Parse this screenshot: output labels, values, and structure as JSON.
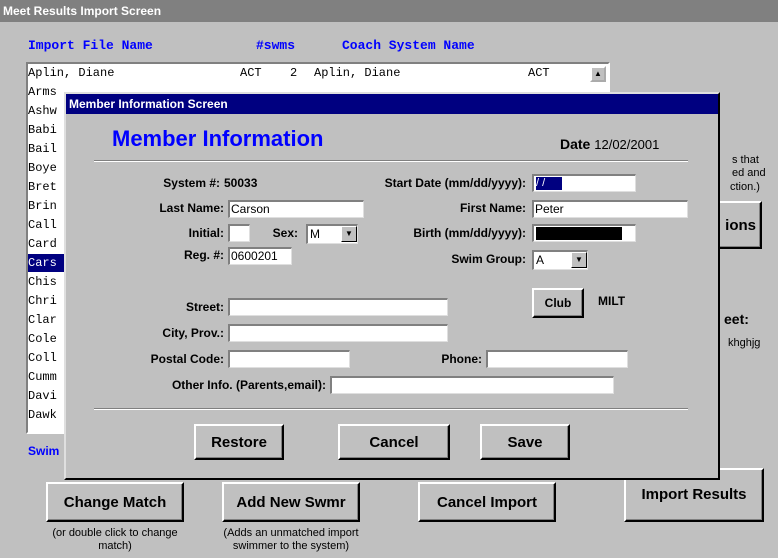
{
  "outer": {
    "title": "Meet Results Import Screen",
    "headers": {
      "import_file": "Import File Name",
      "swms": "#swms",
      "coach": "Coach System Name"
    },
    "rows": [
      {
        "name": "Aplin, Diane",
        "club": "ACT",
        "count": "2",
        "coach_name": "Aplin, Diane",
        "coach_club": "ACT"
      },
      {
        "name": "Arms",
        "club": "",
        "count": "",
        "coach_name": "",
        "coach_club": ""
      },
      {
        "name": "Ashw",
        "club": "",
        "count": "",
        "coach_name": "",
        "coach_club": ""
      },
      {
        "name": "Babi",
        "club": "",
        "count": "",
        "coach_name": "",
        "coach_club": ""
      },
      {
        "name": "Bail",
        "club": "",
        "count": "",
        "coach_name": "",
        "coach_club": ""
      },
      {
        "name": "Boye",
        "club": "",
        "count": "",
        "coach_name": "",
        "coach_club": ""
      },
      {
        "name": "Bret",
        "club": "",
        "count": "",
        "coach_name": "",
        "coach_club": ""
      },
      {
        "name": "Brin",
        "club": "",
        "count": "",
        "coach_name": "",
        "coach_club": ""
      },
      {
        "name": "Call",
        "club": "",
        "count": "",
        "coach_name": "",
        "coach_club": ""
      },
      {
        "name": "Card",
        "club": "",
        "count": "",
        "coach_name": "",
        "coach_club": ""
      },
      {
        "name": "Cars",
        "club": "",
        "count": "",
        "coach_name": "",
        "coach_club": ""
      },
      {
        "name": "Chis",
        "club": "",
        "count": "",
        "coach_name": "",
        "coach_club": ""
      },
      {
        "name": "Chri",
        "club": "",
        "count": "",
        "coach_name": "",
        "coach_club": ""
      },
      {
        "name": "Clar",
        "club": "",
        "count": "",
        "coach_name": "",
        "coach_club": ""
      },
      {
        "name": "Cole",
        "club": "",
        "count": "",
        "coach_name": "",
        "coach_club": ""
      },
      {
        "name": "Coll",
        "club": "",
        "count": "",
        "coach_name": "",
        "coach_club": ""
      },
      {
        "name": "Cumm",
        "club": "",
        "count": "",
        "coach_name": "",
        "coach_club": ""
      },
      {
        "name": "Davi",
        "club": "",
        "count": "",
        "coach_name": "",
        "coach_club": ""
      },
      {
        "name": "Dawk",
        "club": "",
        "count": "",
        "coach_name": "",
        "coach_club": ""
      }
    ],
    "selected_row": "Cars",
    "swim_label": "Swim",
    "side": {
      "line1": "s that",
      "line2": "ed and",
      "line3": "ction.)",
      "btn_fragment": "ions",
      "eet": "eet:",
      "khghjg": "khghjg"
    },
    "buttons": {
      "change_match": "Change Match",
      "change_match_hint": "(or double click to change match)",
      "add_new": "Add New Swmr",
      "add_new_hint": "(Adds an unmatched import swimmer to the system)",
      "cancel_import": "Cancel Import",
      "import_results": "Import Results"
    }
  },
  "modal": {
    "title": "Member Information Screen",
    "heading": "Member Information",
    "date_label": "Date",
    "date_value": "12/02/2001",
    "system_label": "System #:",
    "system_value": "50033",
    "last_name_label": "Last Name:",
    "last_name_value": "Carson",
    "initial_label": "Initial:",
    "initial_value": "",
    "sex_label": "Sex:",
    "sex_value": "M",
    "reg_label": "Reg. #:",
    "reg_value": "0600201",
    "start_date_label": "Start Date (mm/dd/yyyy):",
    "start_date_value": " / /",
    "first_name_label": "First Name:",
    "first_name_value": "Peter",
    "birth_label": "Birth (mm/dd/yyyy):",
    "swim_group_label": "Swim Group:",
    "swim_group_value": "A",
    "club_button": "Club",
    "club_value": "MILT",
    "street_label": "Street:",
    "city_label": "City, Prov.:",
    "postal_label": "Postal Code:",
    "phone_label": "Phone:",
    "other_label": "Other Info. (Parents,email):",
    "restore_button": "Restore",
    "cancel_button": "Cancel",
    "save_button": "Save"
  }
}
